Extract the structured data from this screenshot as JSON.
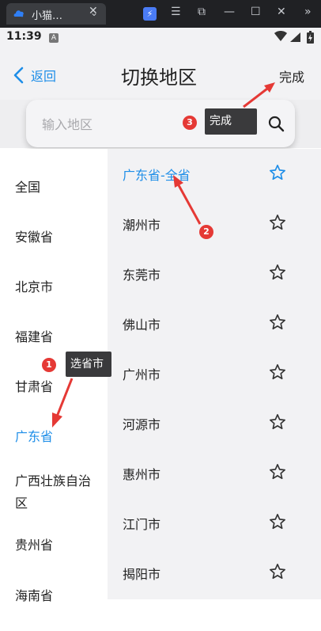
{
  "window": {
    "tab_title": "小猫…",
    "tab_close": "✕",
    "chevron": "⌄",
    "ext_glyph": "⚡",
    "menu_glyph": "☰",
    "minimize_glyph": "—",
    "maximize_glyph": "☐",
    "close_glyph": "✕",
    "more_glyph": "»",
    "crop_glyph": "⧉"
  },
  "status_bar": {
    "time": "11:39",
    "icon_a": "A"
  },
  "header": {
    "back_label": "返回",
    "title": "切换地区",
    "done_label": "完成"
  },
  "search": {
    "placeholder": "输入地区"
  },
  "provinces": [
    {
      "label": "全国"
    },
    {
      "label": "安徽省"
    },
    {
      "label": "北京市"
    },
    {
      "label": "福建省"
    },
    {
      "label": "甘肃省"
    },
    {
      "label": "广东省",
      "selected": true
    },
    {
      "label": "广西壮族自治区"
    },
    {
      "label": "贵州省"
    },
    {
      "label": "海南省"
    }
  ],
  "cities": [
    {
      "label": "广东省-全省",
      "selected": true
    },
    {
      "label": "潮州市"
    },
    {
      "label": "东莞市"
    },
    {
      "label": "佛山市"
    },
    {
      "label": "广州市"
    },
    {
      "label": "河源市"
    },
    {
      "label": "惠州市"
    },
    {
      "label": "江门市"
    },
    {
      "label": "揭阳市"
    }
  ],
  "annotations": {
    "step1": {
      "badge": "1",
      "text": "选省市"
    },
    "step2": {
      "badge": "2"
    },
    "step3": {
      "badge": "3",
      "text": "完成"
    }
  },
  "colors": {
    "accent": "#1e8ee8",
    "annotation_red": "#e53935",
    "callout_bg": "#3a3a3c"
  }
}
